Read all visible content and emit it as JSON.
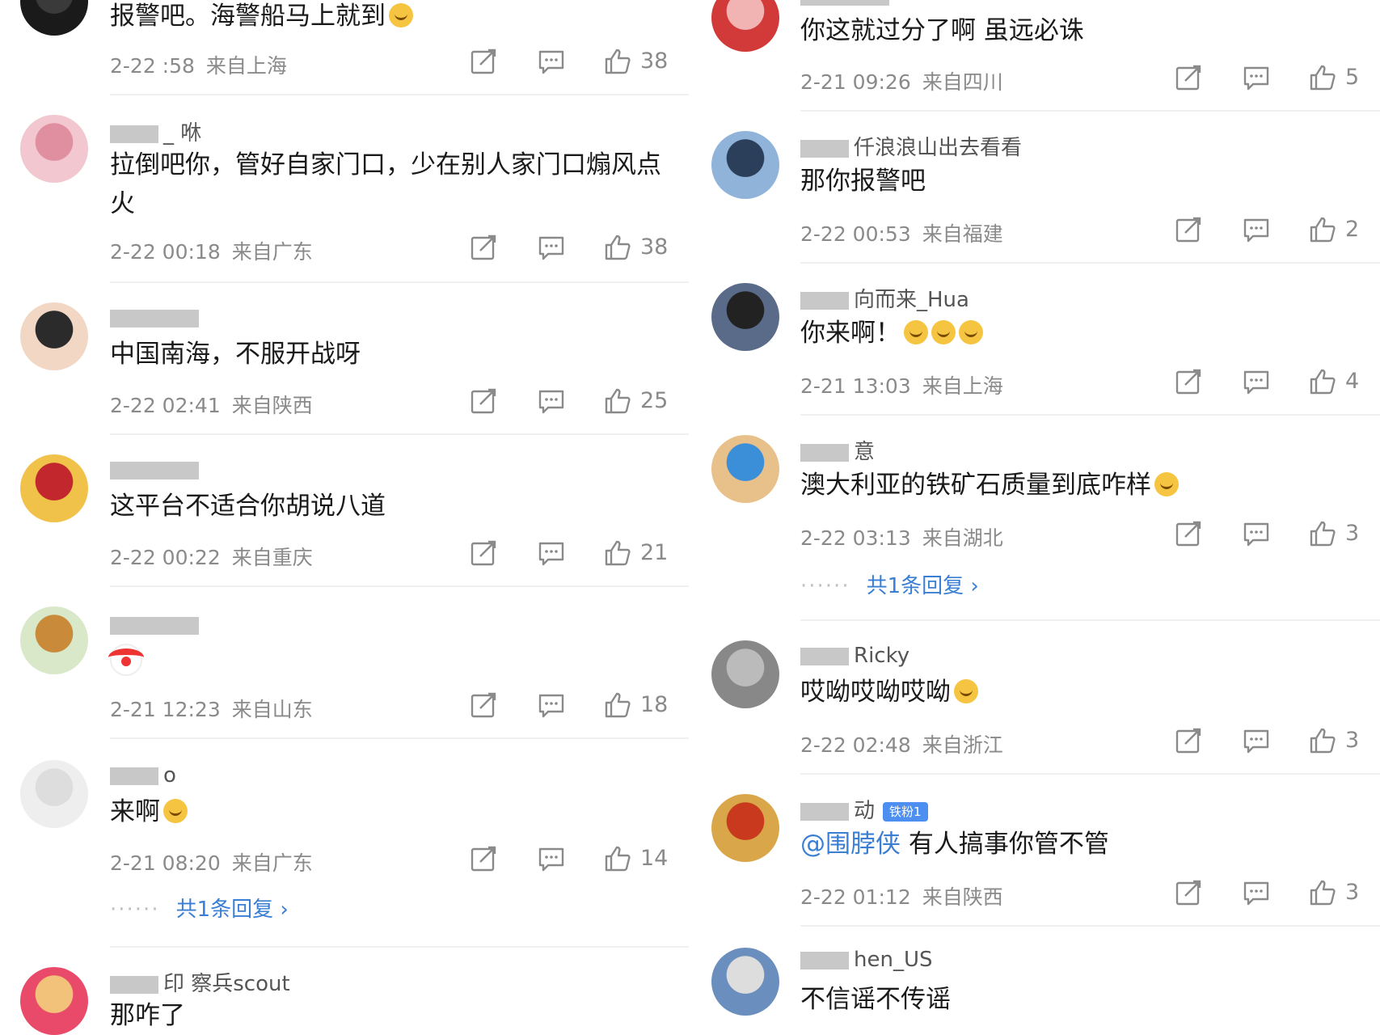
{
  "left_comments": [
    {
      "username": "",
      "text": "报警吧。海警船马上就到",
      "emoji": true,
      "time": "2-22 :58",
      "location": "来自上海",
      "likes": "38"
    },
    {
      "username": "_ 咻",
      "text": "拉倒吧你，管好自家门口，少在别人家门口煽风点火",
      "time": "2-22 00:18",
      "location": "来自广东",
      "likes": "38"
    },
    {
      "username": "",
      "text": "中国南海，不服开战呀",
      "time": "2-22 02:41",
      "location": "来自陕西",
      "likes": "25"
    },
    {
      "username": "",
      "text": "这平台不适合你胡说八道",
      "time": "2-22 00:22",
      "location": "来自重庆",
      "likes": "21"
    },
    {
      "username": "",
      "text": "",
      "clown": true,
      "time": "2-21 12:23",
      "location": "来自山东",
      "likes": "18"
    },
    {
      "username": "o",
      "text": "来啊",
      "emoji": true,
      "time": "2-21 08:20",
      "location": "来自广东",
      "likes": "14",
      "reply": "共1条回复"
    },
    {
      "username": "印 察兵scout",
      "text": "那咋了"
    }
  ],
  "right_comments": [
    {
      "username": "",
      "text": "你这就过分了啊 虽远必诛",
      "time": "2-21 09:26",
      "location": "来自四川",
      "likes": "5"
    },
    {
      "username": "仟浪浪山出去看看",
      "text": "那你报警吧",
      "time": "2-22 00:53",
      "location": "来自福建",
      "likes": "2"
    },
    {
      "username": "向而来_Hua",
      "text": "你来啊！",
      "emoji3": true,
      "time": "2-21 13:03",
      "location": "来自上海",
      "likes": "4"
    },
    {
      "username": "意",
      "text": "澳大利亚的铁矿石质量到底咋样",
      "emoji": true,
      "time": "2-22 03:13",
      "location": "来自湖北",
      "likes": "3",
      "reply": "共1条回复"
    },
    {
      "username": "Ricky",
      "text": "哎呦哎呦哎呦",
      "emoji": true,
      "time": "2-22 02:48",
      "location": "来自浙江",
      "likes": "3"
    },
    {
      "username": "动",
      "badge": "铁粉1",
      "mention": "@围脖侠",
      "text": "有人搞事你管不管",
      "time": "2-22 01:12",
      "location": "来自陕西",
      "likes": "3"
    },
    {
      "username": "hen_US",
      "text": "不信谣不传谣"
    }
  ]
}
